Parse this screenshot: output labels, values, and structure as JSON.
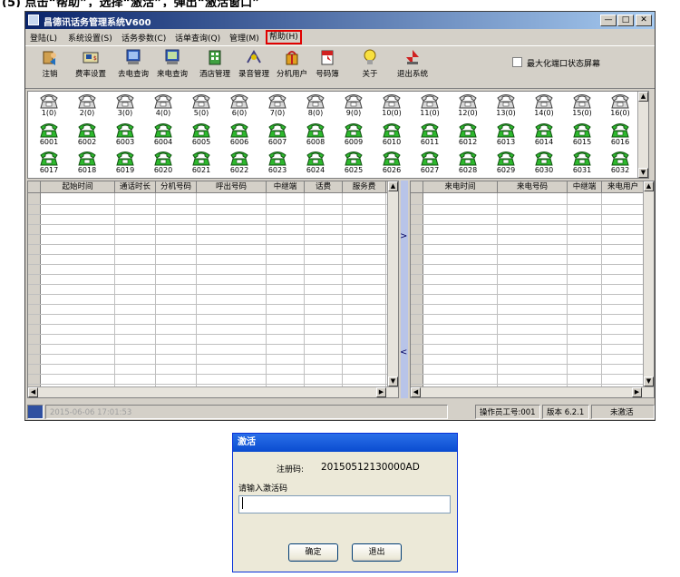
{
  "caption": "(5) 点击“帮助”，选择“激活”，弹出“激活窗口”",
  "window": {
    "title": "昌德讯话务管理系统V600",
    "controls": {
      "minimize": "—",
      "maximize": "□",
      "close": "✕"
    }
  },
  "menu": [
    "登陆(L)",
    "系统设置(S)",
    "话务参数(C)",
    "话单查询(Q)",
    "管理(M)",
    "帮助(H)"
  ],
  "toolbar": [
    {
      "label": "注销",
      "icon": "logout-icon"
    },
    {
      "label": "费率设置",
      "icon": "rate-icon"
    },
    {
      "label": "去电查询",
      "icon": "outgoing-query-icon"
    },
    {
      "label": "来电查询",
      "icon": "incoming-query-icon"
    },
    {
      "label": "酒店管理",
      "icon": "hotel-icon"
    },
    {
      "label": "录音管理",
      "icon": "recording-icon"
    },
    {
      "label": "分机用户",
      "icon": "extension-user-icon"
    },
    {
      "label": "号码簿",
      "icon": "phonebook-icon"
    },
    {
      "label": "关于",
      "icon": "bulb-icon"
    },
    {
      "label": "退出系统",
      "icon": "exit-icon"
    }
  ],
  "maximize_checkbox": "最大化端口状态屏幕",
  "trunk_lines": [
    "1(0)",
    "2(0)",
    "3(0)",
    "4(0)",
    "5(0)",
    "6(0)",
    "7(0)",
    "8(0)",
    "9(0)",
    "10(0)",
    "11(0)",
    "12(0)",
    "13(0)",
    "14(0)",
    "15(0)",
    "16(0)"
  ],
  "extensions_row1": [
    "6001",
    "6002",
    "6003",
    "6004",
    "6005",
    "6006",
    "6007",
    "6008",
    "6009",
    "6010",
    "6011",
    "6012",
    "6013",
    "6014",
    "6015",
    "6016"
  ],
  "extensions_row2": [
    "6017",
    "6018",
    "6019",
    "6020",
    "6021",
    "6022",
    "6023",
    "6024",
    "6025",
    "6026",
    "6027",
    "6028",
    "6029",
    "6030",
    "6031",
    "6032"
  ],
  "outgoing_table": {
    "headers": [
      "起始时间",
      "通话时长",
      "分机号码",
      "呼出号码",
      "中继端",
      "话费",
      "服务费"
    ]
  },
  "incoming_table": {
    "headers": [
      "来电时间",
      "来电号码",
      "中继端",
      "来电用户"
    ]
  },
  "status": {
    "datetime": "2015-06-06 17:01:53",
    "operator": "操作员工号:001",
    "version": "版本 6.2.1",
    "activation": "未激活"
  },
  "dialog": {
    "title": "激活",
    "reg_label": "注册码:",
    "reg_code": "20150512130000AD",
    "prompt": "请输入激活码",
    "input_value": "",
    "ok": "确定",
    "exit": "退出"
  },
  "colors": {
    "title_bar": "#0a246a",
    "extension_phone": "#2db82d",
    "help_highlight": "#e00000",
    "dialog_title": "#0a4cd0"
  }
}
